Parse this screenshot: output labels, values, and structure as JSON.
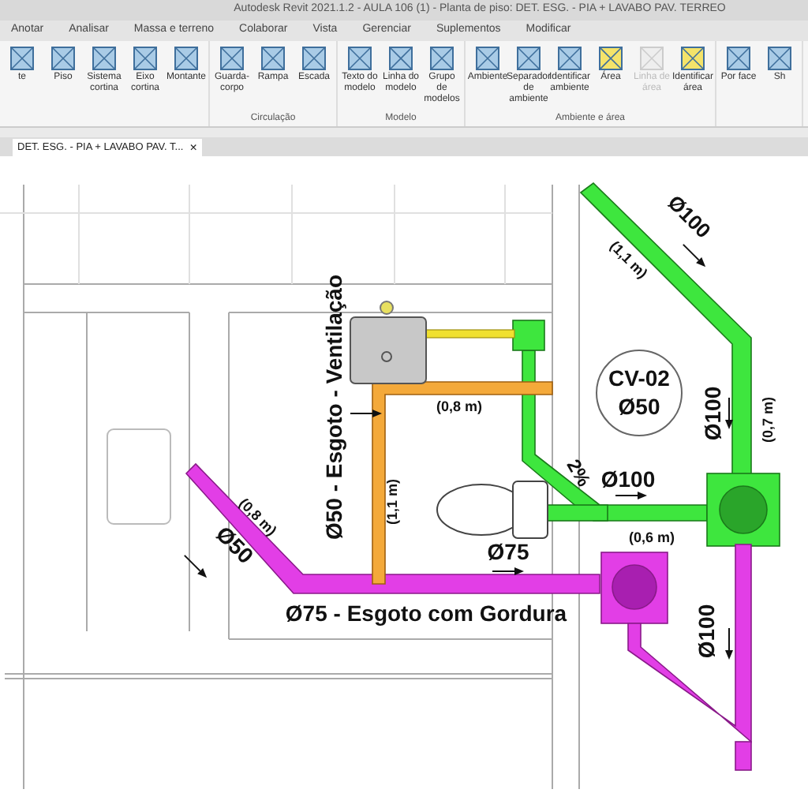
{
  "window": {
    "title": "Autodesk Revit 2021.1.2 - AULA 106 (1) - Planta de piso: DET. ESG. - PIA + LAVABO PAV. TERREO"
  },
  "menu_tabs": [
    {
      "label": "Anotar",
      "selected": false
    },
    {
      "label": "Analisar",
      "selected": false
    },
    {
      "label": "Massa e terreno",
      "selected": false
    },
    {
      "label": "Colaborar",
      "selected": false
    },
    {
      "label": "Vista",
      "selected": false
    },
    {
      "label": "Gerenciar",
      "selected": false
    },
    {
      "label": "Suplementos",
      "selected": false
    },
    {
      "label": "Modificar",
      "selected": false
    }
  ],
  "ribbon": {
    "panels": [
      {
        "buttons": [
          {
            "label": "te",
            "disabled": false
          },
          {
            "label": "Piso",
            "disabled": false
          },
          {
            "label": "Sistema cortina",
            "disabled": false
          },
          {
            "label": "Eixo cortina",
            "disabled": false
          },
          {
            "label": "Montante",
            "disabled": false
          }
        ]
      },
      {
        "label": "Circulação",
        "buttons": [
          {
            "label": "Guarda-corpo",
            "disabled": false
          },
          {
            "label": "Rampa",
            "disabled": false
          },
          {
            "label": "Escada",
            "disabled": false
          }
        ]
      },
      {
        "label": "Modelo",
        "buttons": [
          {
            "label": "Texto do modelo",
            "disabled": false
          },
          {
            "label": "Linha do modelo",
            "disabled": false
          },
          {
            "label": "Grupo de modelos",
            "disabled": false
          }
        ]
      },
      {
        "label": "Ambiente e área",
        "buttons": [
          {
            "label": "Ambiente",
            "disabled": false
          },
          {
            "label": "Separador de ambiente",
            "disabled": false
          },
          {
            "label": "Identificar ambiente",
            "disabled": false
          },
          {
            "label": "Área",
            "disabled": false
          },
          {
            "label": "Linha de área",
            "disabled": true
          },
          {
            "label": "Identificar área",
            "disabled": false
          }
        ]
      },
      {
        "buttons": [
          {
            "label": "Por face",
            "disabled": false
          },
          {
            "label": "Sh",
            "disabled": false
          }
        ]
      }
    ]
  },
  "document_tab": {
    "label": "DET. ESG. - PIA + LAVABO PAV. T...",
    "close": "×"
  },
  "drawing": {
    "labels": [
      {
        "text": "Ø100"
      },
      {
        "text": "(1,1 m)"
      },
      {
        "text": "CV-02"
      },
      {
        "text": "Ø50"
      },
      {
        "text": "Ø100"
      },
      {
        "text": "(0,7 m)"
      },
      {
        "text": "(0,8 m)"
      },
      {
        "text": "(1,1 m)"
      },
      {
        "text": "Ø50 - Esgoto - Ventilação"
      },
      {
        "text": "2%"
      },
      {
        "text": "Ø100"
      },
      {
        "text": "(0,6 m)"
      },
      {
        "text": "Ø75"
      },
      {
        "text": "(0,8 m)"
      },
      {
        "text": "Ø50"
      },
      {
        "text": "Ø75 - Esgoto com Gordura"
      },
      {
        "text": "Ø100"
      }
    ]
  }
}
